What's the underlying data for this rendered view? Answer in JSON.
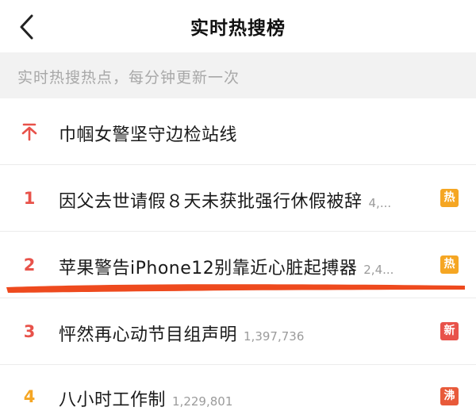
{
  "header": {
    "title": "实时热搜榜",
    "back_icon": "chevron-left-icon"
  },
  "subbar": {
    "text": "实时热搜热点，每分钟更新一次"
  },
  "pinned": {
    "icon": "pin-top-icon",
    "topic": "巾帼女警坚守边检站线",
    "color": "#e8524a"
  },
  "items": [
    {
      "rank": "1",
      "topic": "因父去世请假８天未获批强行休假被辞",
      "count": "4,...",
      "badge": "热",
      "badge_color": "#f5a623",
      "rank_color": "#e8524a"
    },
    {
      "rank": "2",
      "topic": "苹果警告iPhone12别靠近心脏起搏器",
      "count": "2,4...",
      "badge": "热",
      "badge_color": "#f5a623",
      "rank_color": "#e8524a"
    },
    {
      "rank": "3",
      "topic": "怦然再心动节目组声明",
      "count": "1,397,736",
      "badge": "新",
      "badge_color": "#e8524a",
      "rank_color": "#e8524a"
    },
    {
      "rank": "4",
      "topic": "八小时工作制",
      "count": "1,229,801",
      "badge": "沸",
      "badge_color": "#e85a3a",
      "rank_color": "#f5a623"
    }
  ],
  "annotation": {
    "color": "#ee4a1e"
  }
}
